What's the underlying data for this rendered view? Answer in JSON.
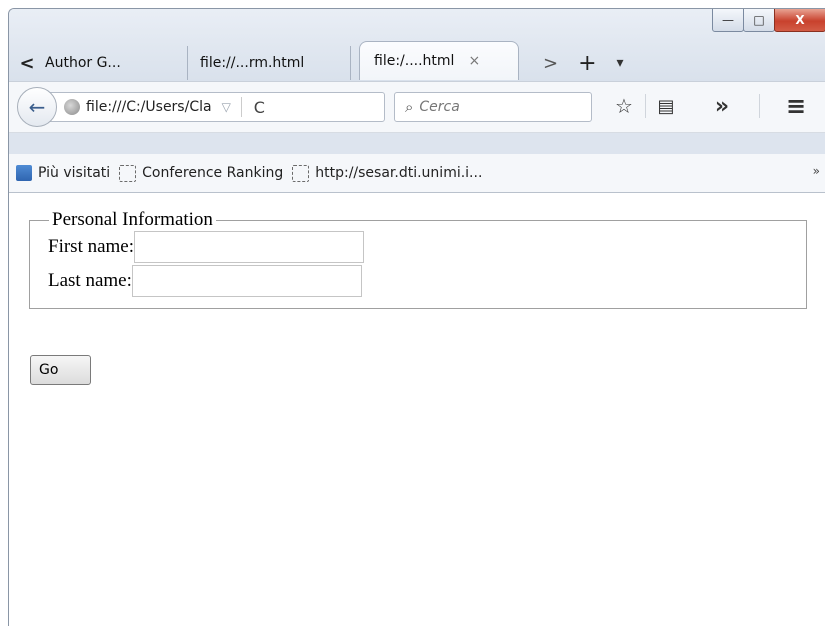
{
  "window": {
    "controls": {
      "minimize": "—",
      "maximize": "□",
      "close": "X"
    }
  },
  "tabs": {
    "scroll_left": "<",
    "items": [
      {
        "label": "Author G..."
      },
      {
        "label": "file://...rm.html"
      },
      {
        "label": "file:/....html",
        "active": true,
        "close": "×"
      }
    ],
    "scroll_right": ">",
    "new_tab": "+",
    "list_all": "▾"
  },
  "navbar": {
    "back": "←",
    "url": "file:///C:/Users/Cla",
    "url_dropdown": "▽",
    "reload": "C",
    "search_placeholder": "Cerca",
    "bookmark_star": "☆",
    "reading_list": "▤",
    "overflow": "»",
    "menu": "≡"
  },
  "bookmarks": {
    "items": [
      {
        "label": "Più visitati",
        "icon": "folder-icon"
      },
      {
        "label": "Conference Ranking",
        "icon": "page-icon"
      },
      {
        "label": "http://sesar.dti.unimi.i...",
        "icon": "page-icon"
      }
    ],
    "overflow": "»"
  },
  "form": {
    "legend": "Personal Information",
    "first_name_label": "First name:",
    "first_name_value": "",
    "last_name_label": "Last name:",
    "last_name_value": "",
    "submit_label": "Go"
  },
  "colors": {
    "close_button": "#c8412d",
    "back_arrow": "#3b5e8c"
  }
}
